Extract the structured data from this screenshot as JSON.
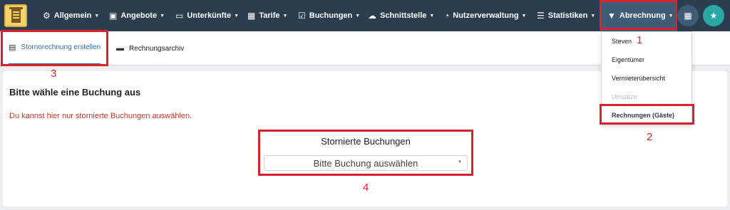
{
  "nav": {
    "items": [
      {
        "icon": "⚙",
        "label": "Allgemein"
      },
      {
        "icon": "▣",
        "label": "Angebote"
      },
      {
        "icon": "▭",
        "label": "Unterkünfte"
      },
      {
        "icon": "▦",
        "label": "Tarife"
      },
      {
        "icon": "☑",
        "label": "Buchungen"
      },
      {
        "icon": "☁",
        "label": "Schnittstelle"
      },
      {
        "icon": "◔",
        "label": "Nutzerverwaltung"
      },
      {
        "icon": "☰",
        "label": "Statistiken"
      },
      {
        "icon": "▼",
        "label": "Abrechnung"
      }
    ],
    "apps_icon": "▦",
    "star_icon": "★"
  },
  "tabs": [
    {
      "icon": "▤",
      "label": "Stornorechnung erstellen"
    },
    {
      "icon": "▬",
      "label": "Rechnungsarchiv"
    }
  ],
  "main": {
    "heading": "Bitte wähle eine Buchung aus",
    "warning": "Du kannst hier nur stornierte Buchungen auswählen.",
    "field_label": "Stornierte Buchungen",
    "select_value": "Bitte Buchung auswählen"
  },
  "dropdown": {
    "items": [
      "Steven",
      "Eigentümer",
      "Vermieterübersicht",
      "Umsätze",
      "Rechnungen (Gäste)"
    ]
  },
  "annotations": [
    "1",
    "2",
    "3",
    "4"
  ],
  "colors": {
    "navbar": "#2b3d4f",
    "accent": "#2e6aa3",
    "annotation": "#d8232a",
    "warning": "#c0392b"
  }
}
